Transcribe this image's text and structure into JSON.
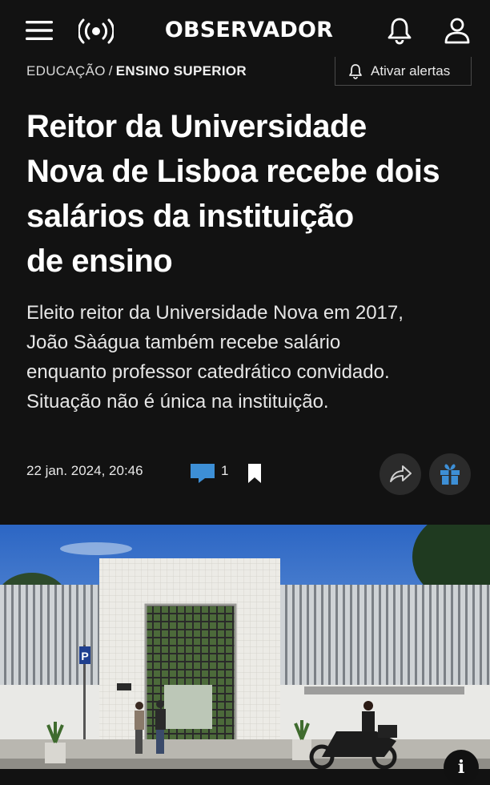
{
  "header": {
    "logo_text": "OBSERVADOR",
    "icons": [
      "menu-icon",
      "live-radio-icon",
      "bell-icon",
      "user-icon"
    ]
  },
  "breadcrumb": {
    "section": "EDUCAÇÃO",
    "separator": "/",
    "subsection": "ENSINO SUPERIOR"
  },
  "alert_button": {
    "label": "Ativar alertas",
    "icon": "bell-icon"
  },
  "article": {
    "headline_lines": [
      "Reitor da Universidade",
      "Nova de Lisboa recebe dois",
      "salários da instituição",
      "de ensino"
    ],
    "lede_lines": [
      "Eleito reitor da Universidade Nova em 2017,",
      "João Sàágua também recebe salário",
      "enquanto professor catedrático convidado.",
      "Situação não é única na instituição."
    ],
    "date": "22 jan. 2024, 20:46",
    "comment_count": "1"
  },
  "actions": {
    "icons": [
      "comment-icon",
      "bookmark-icon",
      "share-icon",
      "gift-icon"
    ],
    "comment_color": "#3d8fd6",
    "gift_color": "#3d8fd6"
  },
  "photo": {
    "icons": [
      "info-icon",
      "parking-sign-icon"
    ],
    "info_label": "i",
    "parking_label": "P"
  },
  "colors": {
    "background": "#121212",
    "text": "#ffffff",
    "accent_blue": "#3d8fd6"
  }
}
